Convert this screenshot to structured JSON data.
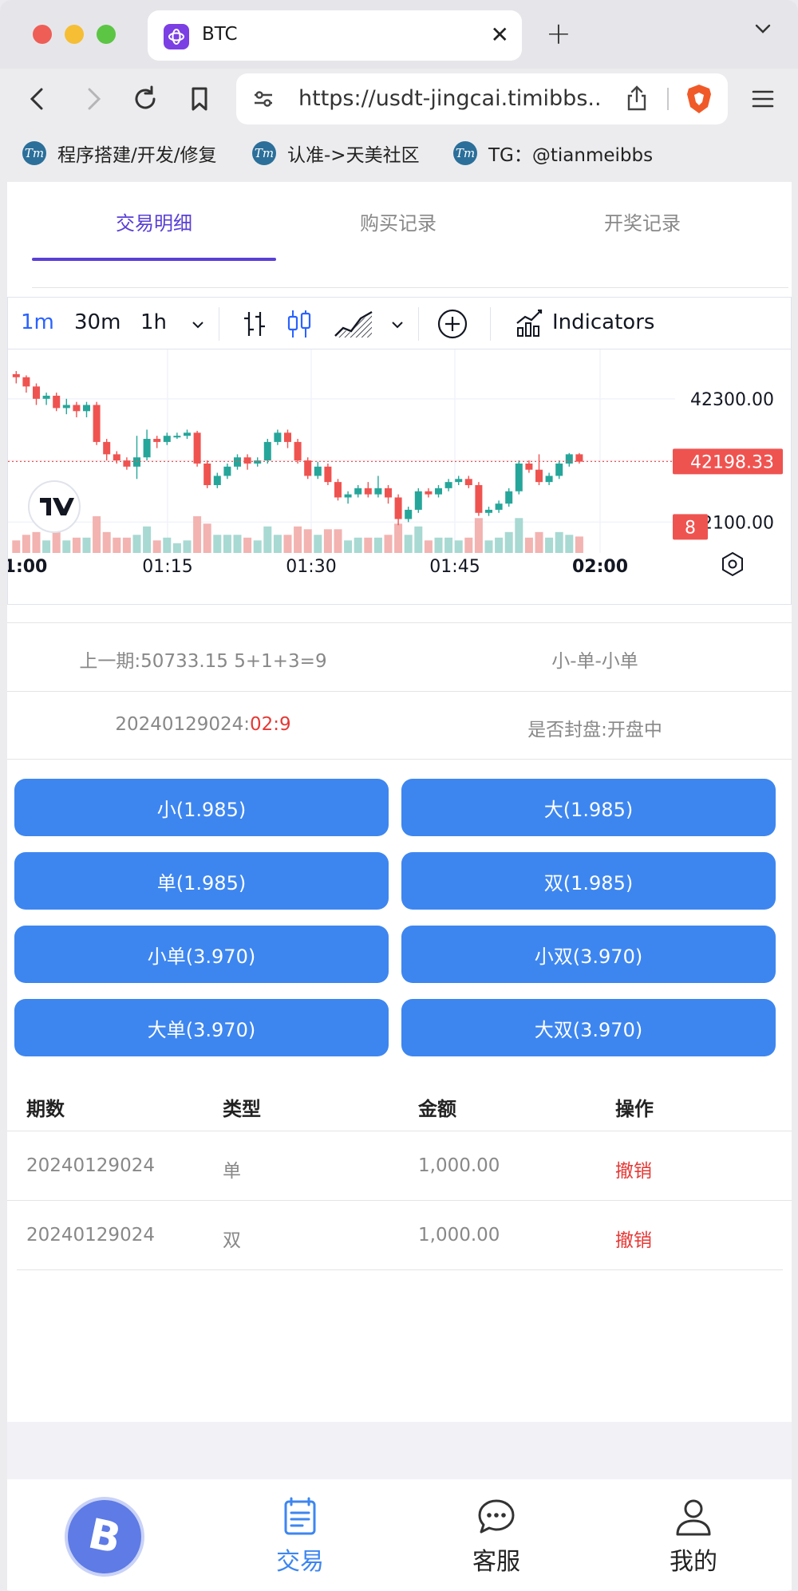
{
  "browser": {
    "tab_title": "BTC",
    "url": "https://usdt-jingcai.timibbs...",
    "bookmarks": [
      "程序搭建/开发/修复",
      "认准->天美社区",
      "TG：@tianmeibbs"
    ],
    "bookmark_icon_text": "Tm",
    "new_tab_label": "+",
    "close_tab_label": "✕"
  },
  "page_tabs": [
    {
      "label": "交易明细",
      "active": true
    },
    {
      "label": "购买记录",
      "active": false
    },
    {
      "label": "开奖记录",
      "active": false
    }
  ],
  "chart_toolbar": {
    "intervals": [
      "1m",
      "30m",
      "1h"
    ],
    "active_interval": "1m",
    "indicators_label": "Indicators"
  },
  "chart_data": {
    "type": "candlestick",
    "price_labels": [
      "42300.00",
      "42100.00"
    ],
    "current_price": "42198.33",
    "countdown_badge": "8",
    "time_labels": [
      "1:00",
      "01:15",
      "01:30",
      "01:45",
      "02:00"
    ],
    "ylim": [
      42050,
      42380
    ],
    "up_color": "#26a69a",
    "down_color": "#ef5350",
    "candles": [
      [
        42340,
        42335,
        42345,
        42325
      ],
      [
        42335,
        42320,
        42338,
        42310
      ],
      [
        42320,
        42300,
        42325,
        42290
      ],
      [
        42300,
        42305,
        42310,
        42290
      ],
      [
        42305,
        42285,
        42310,
        42280
      ],
      [
        42285,
        42290,
        42300,
        42275
      ],
      [
        42290,
        42280,
        42295,
        42270
      ],
      [
        42280,
        42290,
        42295,
        42270
      ],
      [
        42290,
        42230,
        42295,
        42225
      ],
      [
        42230,
        42210,
        42235,
        42200
      ],
      [
        42210,
        42200,
        42215,
        42195
      ],
      [
        42200,
        42190,
        42205,
        42185
      ],
      [
        42190,
        42205,
        42240,
        42170
      ],
      [
        42205,
        42235,
        42250,
        42200
      ],
      [
        42235,
        42230,
        42240,
        42220
      ],
      [
        42230,
        42240,
        42245,
        42225
      ],
      [
        42240,
        42240,
        42245,
        42235
      ],
      [
        42240,
        42245,
        42250,
        42235
      ],
      [
        42245,
        42195,
        42248,
        42190
      ],
      [
        42195,
        42160,
        42200,
        42155
      ],
      [
        42160,
        42175,
        42180,
        42155
      ],
      [
        42175,
        42190,
        42195,
        42170
      ],
      [
        42190,
        42205,
        42210,
        42185
      ],
      [
        42205,
        42195,
        42210,
        42185
      ],
      [
        42195,
        42200,
        42205,
        42190
      ],
      [
        42200,
        42230,
        42235,
        42195
      ],
      [
        42230,
        42245,
        42250,
        42225
      ],
      [
        42245,
        42230,
        42250,
        42220
      ],
      [
        42230,
        42200,
        42235,
        42195
      ],
      [
        42200,
        42175,
        42205,
        42170
      ],
      [
        42175,
        42190,
        42198,
        42170
      ],
      [
        42190,
        42165,
        42195,
        42160
      ],
      [
        42165,
        42140,
        42170,
        42135
      ],
      [
        42140,
        42145,
        42150,
        42130
      ],
      [
        42145,
        42155,
        42160,
        42140
      ],
      [
        42155,
        42145,
        42165,
        42140
      ],
      [
        42145,
        42155,
        42175,
        42140
      ],
      [
        42155,
        42140,
        42160,
        42130
      ],
      [
        42140,
        42105,
        42145,
        42095
      ],
      [
        42105,
        42120,
        42125,
        42100
      ],
      [
        42120,
        42150,
        42155,
        42115
      ],
      [
        42150,
        42145,
        42155,
        42140
      ],
      [
        42145,
        42155,
        42160,
        42140
      ],
      [
        42155,
        42165,
        42170,
        42150
      ],
      [
        42165,
        42170,
        42175,
        42160
      ],
      [
        42170,
        42160,
        42175,
        42155
      ],
      [
        42160,
        42115,
        42165,
        42110
      ],
      [
        42115,
        42120,
        42125,
        42110
      ],
      [
        42120,
        42130,
        42135,
        42115
      ],
      [
        42130,
        42150,
        42155,
        42125
      ],
      [
        42150,
        42195,
        42200,
        42145
      ],
      [
        42195,
        42185,
        42200,
        42180
      ],
      [
        42185,
        42165,
        42210,
        42160
      ],
      [
        42165,
        42175,
        42180,
        42160
      ],
      [
        42175,
        42195,
        42200,
        42170
      ],
      [
        42195,
        42210,
        42212,
        42190
      ],
      [
        42210,
        42198,
        42212,
        42195
      ]
    ]
  },
  "last_period": {
    "text": "上一期:50733.15 5+1+3=9",
    "result": "小-单-小单"
  },
  "current_period": {
    "id": "20240129024:",
    "countdown": "02:9",
    "status": "是否封盘:开盘中"
  },
  "bet_buttons": [
    "小(1.985)",
    "大(1.985)",
    "单(1.985)",
    "双(1.985)",
    "小单(3.970)",
    "小双(3.970)",
    "大单(3.970)",
    "大双(3.970)"
  ],
  "table": {
    "headers": [
      "期数",
      "类型",
      "金额",
      "操作"
    ],
    "rows": [
      [
        "20240129024",
        "单",
        "1,000.00",
        "撤销"
      ],
      [
        "20240129024",
        "双",
        "1,000.00",
        "撤销"
      ]
    ]
  },
  "bottom_nav": [
    {
      "label": "交易",
      "icon": "document-list-icon",
      "active": true
    },
    {
      "label": "客服",
      "icon": "chat-bubble-icon",
      "active": false
    },
    {
      "label": "我的",
      "icon": "user-icon",
      "active": false
    }
  ],
  "colors": {
    "accent": "#5a3fd6",
    "button": "#3d86f0",
    "danger": "#e53935"
  }
}
